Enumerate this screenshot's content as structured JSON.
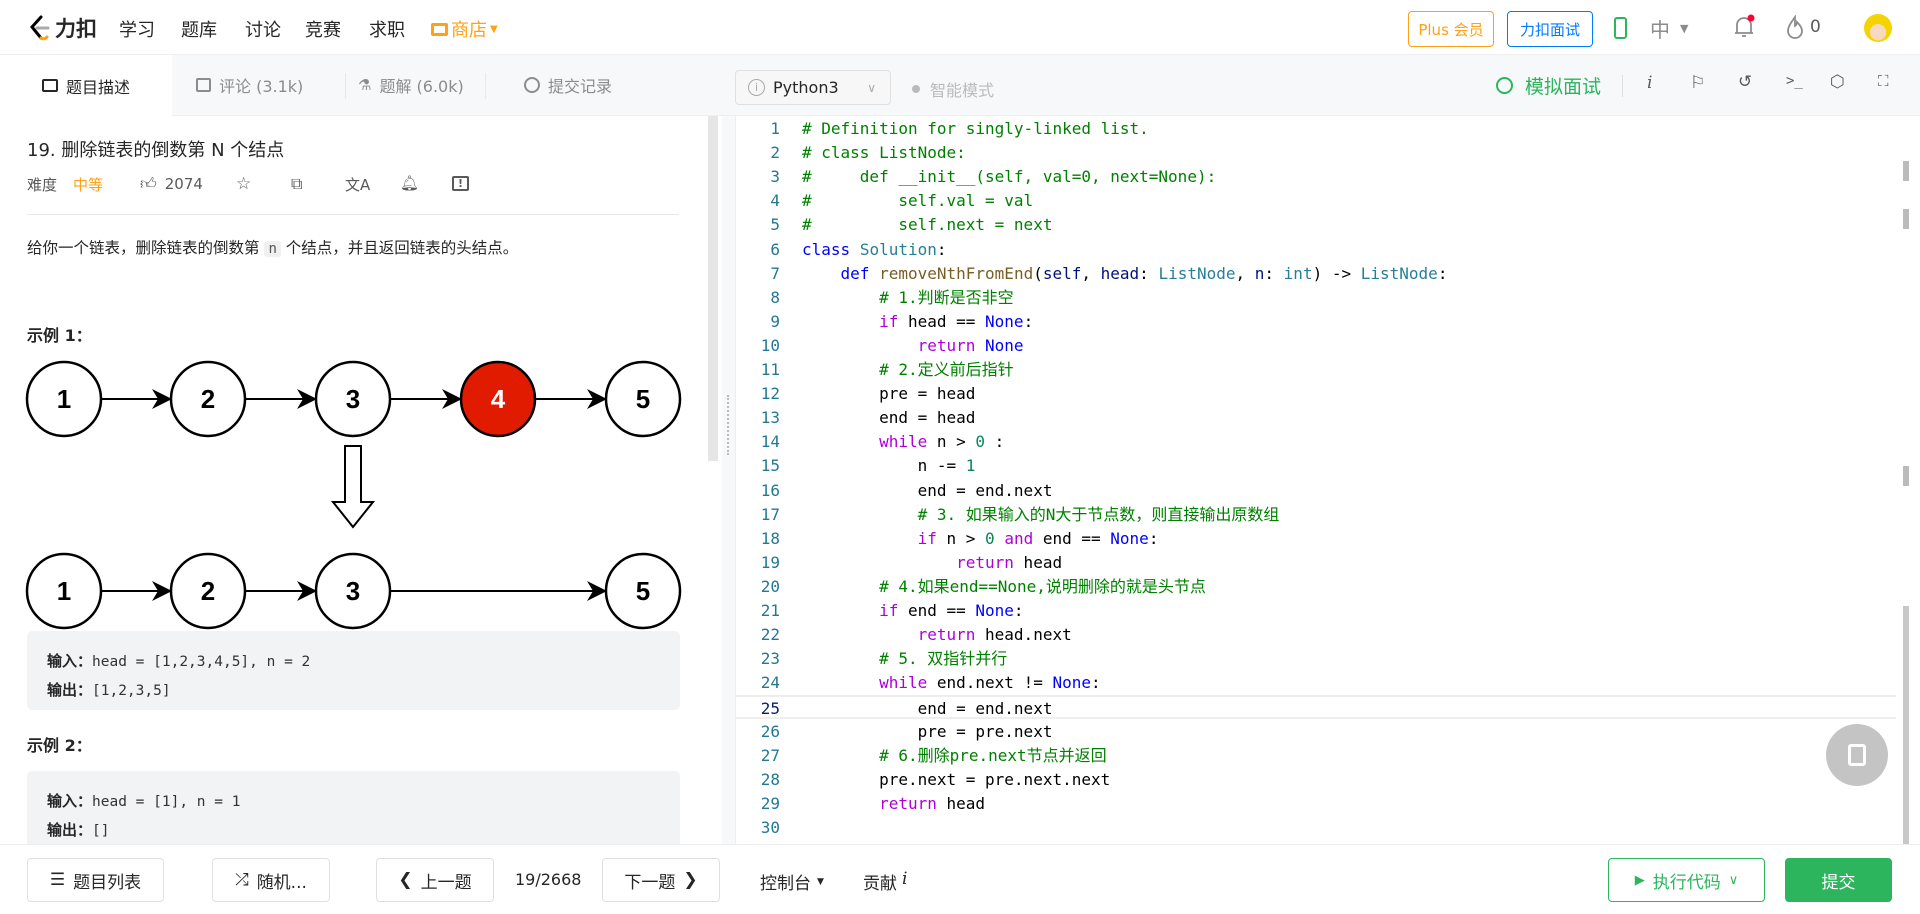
{
  "brand": {
    "logo_text": "力扣"
  },
  "nav": {
    "items": [
      "学习",
      "题库",
      "讨论",
      "竞赛",
      "求职"
    ],
    "shop": "商店"
  },
  "header_right": {
    "plus": "Plus 会员",
    "interview": "力扣面试",
    "lang": "中",
    "streak": "0"
  },
  "tabs": [
    {
      "label": "题目描述",
      "icon": "description-icon"
    },
    {
      "label": "评论 (3.1k)",
      "icon": "comment-icon"
    },
    {
      "label": "题解 (6.0k)",
      "icon": "flask-icon"
    },
    {
      "label": "提交记录",
      "icon": "clock-icon"
    }
  ],
  "problem": {
    "title": "19. 删除链表的倒数第 N 个结点",
    "difficulty_label": "难度",
    "difficulty": "中等",
    "likes": "2074",
    "desc_before": "给你一个链表，删除链表的倒数第 ",
    "desc_code": "n",
    "desc_after": " 个结点，并且返回链表的头结点。",
    "example1_title": "示例 1：",
    "diagram_before": [
      "1",
      "2",
      "3",
      "4",
      "5"
    ],
    "diagram_after": [
      "1",
      "2",
      "3",
      "5"
    ],
    "removed_node": "4",
    "example1": {
      "in_label": "输入：",
      "in": "head = [1,2,3,4,5], n = 2",
      "out_label": "输出：",
      "out": "[1,2,3,5]"
    },
    "example2_title": "示例 2：",
    "example2": {
      "in_label": "输入：",
      "in": "head = [1], n = 1",
      "out_label": "输出：",
      "out": "[]"
    }
  },
  "editor": {
    "language": "Python3",
    "smart_mode": "智能模式",
    "mock_interview": "模拟面试",
    "current_line": 25,
    "lines": [
      [
        [
          "c",
          "# Definition for singly-linked list."
        ]
      ],
      [
        [
          "c",
          "# class ListNode:"
        ]
      ],
      [
        [
          "c",
          "#     def __init__(self, val=0, next=None):"
        ]
      ],
      [
        [
          "c",
          "#         self.val = val"
        ]
      ],
      [
        [
          "c",
          "#         self.next = next"
        ]
      ],
      [
        [
          "d",
          "class"
        ],
        [
          "x",
          " "
        ],
        [
          "t",
          "Solution"
        ],
        [
          "x",
          ":"
        ]
      ],
      [
        [
          "x",
          "    "
        ],
        [
          "d",
          "def"
        ],
        [
          "x",
          " "
        ],
        [
          "f",
          "removeNthFromEnd"
        ],
        [
          "x",
          "("
        ],
        [
          "p",
          "self"
        ],
        [
          "x",
          ", "
        ],
        [
          "p",
          "head"
        ],
        [
          "x",
          ": "
        ],
        [
          "t",
          "ListNode"
        ],
        [
          "x",
          ", "
        ],
        [
          "p",
          "n"
        ],
        [
          "x",
          ": "
        ],
        [
          "t",
          "int"
        ],
        [
          "x",
          ") -> "
        ],
        [
          "t",
          "ListNode"
        ],
        [
          "x",
          ":"
        ]
      ],
      [
        [
          "x",
          "        "
        ],
        [
          "c",
          "# 1.判断是否非空"
        ]
      ],
      [
        [
          "x",
          "        "
        ],
        [
          "k",
          "if"
        ],
        [
          "x",
          " head == "
        ],
        [
          "n",
          "None"
        ],
        [
          "x",
          ":"
        ]
      ],
      [
        [
          "x",
          "            "
        ],
        [
          "k",
          "return"
        ],
        [
          "x",
          " "
        ],
        [
          "n",
          "None"
        ]
      ],
      [
        [
          "x",
          "        "
        ],
        [
          "c",
          "# 2.定义前后指针"
        ]
      ],
      [
        [
          "x",
          "        pre = head"
        ]
      ],
      [
        [
          "x",
          "        end = head"
        ]
      ],
      [
        [
          "x",
          "        "
        ],
        [
          "k",
          "while"
        ],
        [
          "x",
          " n > "
        ],
        [
          "num",
          "0"
        ],
        [
          "x",
          " :"
        ]
      ],
      [
        [
          "x",
          "            n -= "
        ],
        [
          "num",
          "1"
        ]
      ],
      [
        [
          "x",
          "            end = end.next"
        ]
      ],
      [
        [
          "x",
          "            "
        ],
        [
          "c",
          "# 3. 如果输入的N大于节点数，则直接输出原数组"
        ]
      ],
      [
        [
          "x",
          "            "
        ],
        [
          "k",
          "if"
        ],
        [
          "x",
          " n > "
        ],
        [
          "num",
          "0"
        ],
        [
          "x",
          " "
        ],
        [
          "k",
          "and"
        ],
        [
          "x",
          " end == "
        ],
        [
          "n",
          "None"
        ],
        [
          "x",
          ":"
        ]
      ],
      [
        [
          "x",
          "                "
        ],
        [
          "k",
          "return"
        ],
        [
          "x",
          " head"
        ]
      ],
      [
        [
          "x",
          "        "
        ],
        [
          "c",
          "# 4.如果end==None,说明删除的就是头节点"
        ]
      ],
      [
        [
          "x",
          "        "
        ],
        [
          "k",
          "if"
        ],
        [
          "x",
          " end == "
        ],
        [
          "n",
          "None"
        ],
        [
          "x",
          ":"
        ]
      ],
      [
        [
          "x",
          "            "
        ],
        [
          "k",
          "return"
        ],
        [
          "x",
          " head.next"
        ]
      ],
      [
        [
          "x",
          "        "
        ],
        [
          "c",
          "# 5. 双指针并行"
        ]
      ],
      [
        [
          "x",
          "        "
        ],
        [
          "k",
          "while"
        ],
        [
          "x",
          " end.next != "
        ],
        [
          "n",
          "None"
        ],
        [
          "x",
          ":"
        ]
      ],
      [
        [
          "x",
          "            end = end.next"
        ]
      ],
      [
        [
          "x",
          "            pre = pre.next"
        ]
      ],
      [
        [
          "x",
          "        "
        ],
        [
          "c",
          "# 6.删除pre.next节点并返回"
        ]
      ],
      [
        [
          "x",
          "        pre.next = pre.next.next"
        ]
      ],
      [
        [
          "x",
          "        "
        ],
        [
          "k",
          "return"
        ],
        [
          "x",
          " head"
        ]
      ],
      []
    ]
  },
  "bottom": {
    "list": "题目列表",
    "random": "随机...",
    "prev": "上一题",
    "counter": "19/2668",
    "next": "下一题",
    "console": "控制台",
    "contribute": "贡献",
    "run": "执行代码",
    "submit": "提交"
  },
  "colors": {
    "accent_green": "#2db55d",
    "orange": "#ffa116",
    "blue": "#007aff",
    "removed_node": "#e01b00"
  }
}
